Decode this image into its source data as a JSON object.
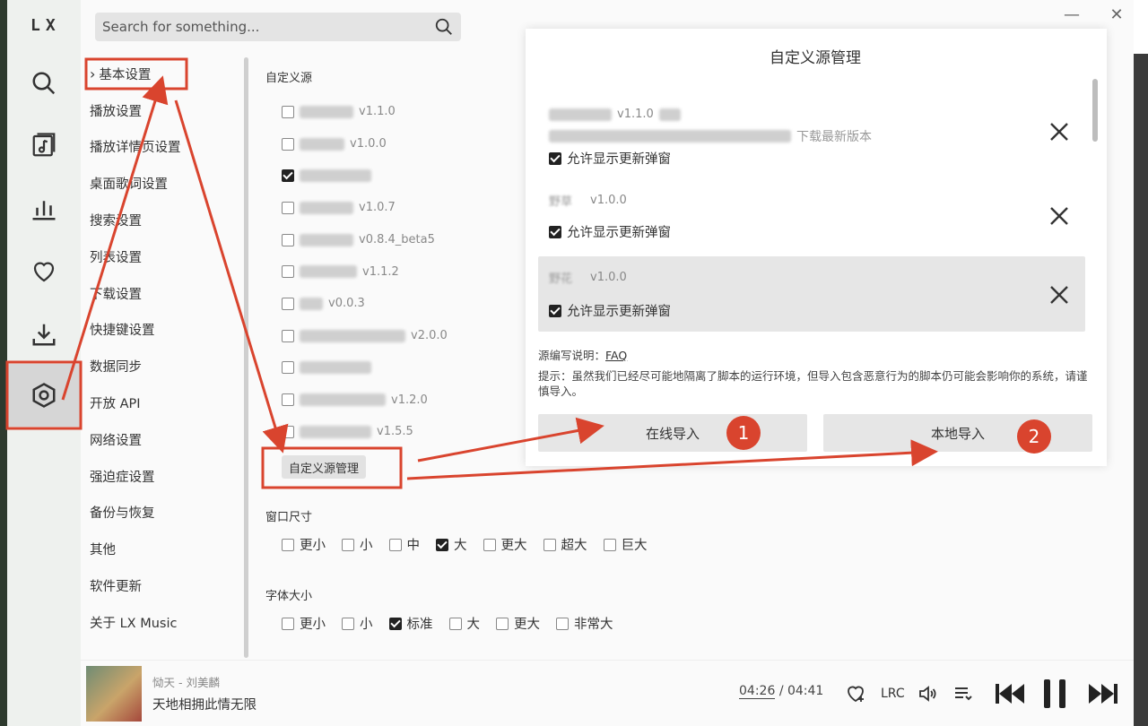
{
  "app": {
    "logo": "LX"
  },
  "search": {
    "placeholder": "Search for something..."
  },
  "window": {
    "minimize": "—",
    "close": "✕"
  },
  "menu": {
    "items": [
      "基本设置",
      "播放设置",
      "播放详情页设置",
      "桌面歌词设置",
      "搜索设置",
      "列表设置",
      "下载设置",
      "快捷键设置",
      "数据同步",
      "开放 API",
      "网络设置",
      "强迫症设置",
      "备份与恢复",
      "其他",
      "软件更新",
      "关于 LX Music"
    ],
    "active_index": 0
  },
  "custom_sources": {
    "title": "自定义源",
    "items": [
      {
        "version": "v1.1.0",
        "checked": false
      },
      {
        "version": "v1.0.0",
        "checked": false
      },
      {
        "version": "",
        "checked": true
      },
      {
        "version": "v1.0.7",
        "checked": false
      },
      {
        "version": "v0.8.4_beta5",
        "checked": false
      },
      {
        "version": "v1.1.2",
        "checked": false
      },
      {
        "version": "v0.0.3",
        "checked": false
      },
      {
        "version": "v2.0.0",
        "checked": false
      },
      {
        "version": "",
        "checked": false
      },
      {
        "version": "v1.2.0",
        "checked": false
      },
      {
        "version": "v1.5.5",
        "checked": false
      }
    ],
    "manage_label": "自定义源管理"
  },
  "window_size": {
    "title": "窗口尺寸",
    "options": [
      "更小",
      "小",
      "中",
      "大",
      "更大",
      "超大",
      "巨大"
    ],
    "selected": "大"
  },
  "font_size": {
    "title": "字体大小",
    "options": [
      "更小",
      "小",
      "标准",
      "大",
      "更大",
      "非常大"
    ],
    "selected": "标准"
  },
  "dialog": {
    "title": "自定义源管理",
    "sources": [
      {
        "version": "v1.1.0",
        "desc_suffix": "下载最新版本",
        "allow_label": "允许显示更新弹窗",
        "highlighted": false
      },
      {
        "name": "野草",
        "version": "v1.0.0",
        "allow_label": "允许显示更新弹窗",
        "highlighted": false
      },
      {
        "name": "野花",
        "version": "v1.0.0",
        "allow_label": "允许显示更新弹窗",
        "highlighted": true
      }
    ],
    "doc_label": "源编写说明：",
    "faq_label": "FAQ",
    "warning": "提示：虽然我们已经尽可能地隔离了脚本的运行环境，但导入包含恶意行为的脚本仍可能会影响你的系统，请谨慎导入。",
    "online_import": "在线导入",
    "local_import": "本地导入",
    "badge_online": "1",
    "badge_local": "2"
  },
  "player": {
    "song": "恸天 - 刘美麟",
    "lyric": "天地相拥此情无限",
    "current_time": "04:26",
    "separator": "/",
    "total_time": "04:41",
    "lrc_label": "LRC"
  },
  "colors": {
    "accent": "#d9442e"
  }
}
